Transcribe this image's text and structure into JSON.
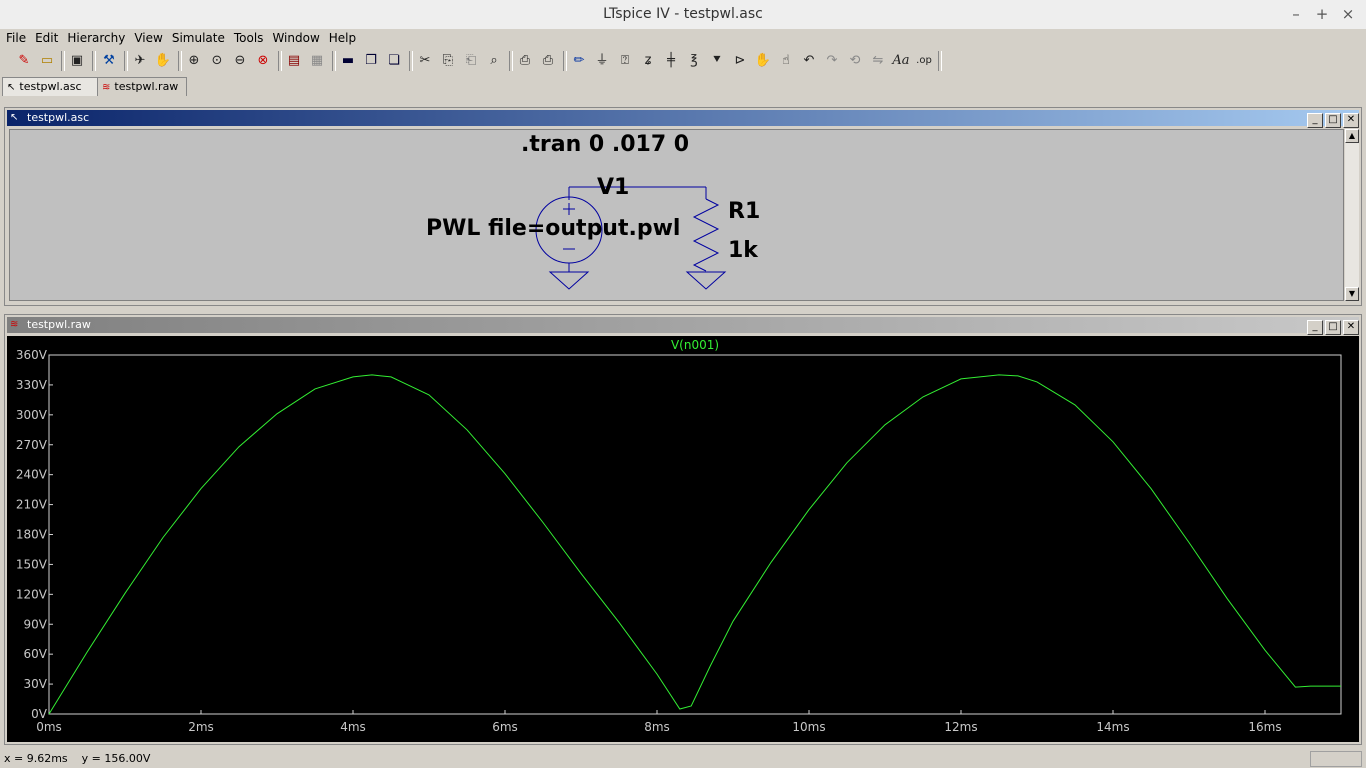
{
  "window": {
    "title": "LTspice IV - testpwl.asc"
  },
  "menu": [
    "File",
    "Edit",
    "Hierarchy",
    "View",
    "Simulate",
    "Tools",
    "Window",
    "Help"
  ],
  "tabs": [
    {
      "label": "testpwl.asc",
      "icon": "schematic-icon"
    },
    {
      "label": "testpwl.raw",
      "icon": "waveform-icon"
    }
  ],
  "schematic_window": {
    "title": "testpwl.asc",
    "directive": ".tran 0 .017 0",
    "source_name": "V1",
    "source_value": "PWL file=output.pwl",
    "resistor_name": "R1",
    "resistor_value": "1k"
  },
  "waveform_window": {
    "title": "testpwl.raw",
    "trace_color": "#33ee33"
  },
  "status": {
    "coords": "x = 9.62ms    y = 156.00V"
  },
  "chart_data": {
    "type": "line",
    "series": [
      {
        "name": "V(n001)",
        "x_unit": "ms",
        "x": [
          0,
          0.5,
          1,
          1.5,
          2,
          2.5,
          3,
          3.5,
          4,
          4.25,
          4.5,
          5,
          5.5,
          6,
          6.5,
          7,
          7.5,
          8,
          8.3,
          8.45,
          8.7,
          9,
          9.5,
          10,
          10.5,
          11,
          11.5,
          12,
          12.5,
          12.75,
          13,
          13.5,
          14,
          14.5,
          15,
          15.5,
          16,
          16.4,
          16.6,
          17
        ],
        "y": [
          0,
          62,
          121,
          177,
          226,
          268,
          301,
          326,
          338,
          340,
          338,
          320,
          285,
          241,
          192,
          141,
          92,
          40,
          5,
          8,
          48,
          93,
          152,
          205,
          252,
          290,
          318,
          336,
          340,
          339,
          333,
          310,
          273,
          226,
          172,
          116,
          64,
          27,
          28,
          28
        ]
      }
    ],
    "xlim": [
      0,
      17
    ],
    "ylim": [
      0,
      360
    ],
    "x_ticks": [
      "0ms",
      "2ms",
      "4ms",
      "6ms",
      "8ms",
      "10ms",
      "12ms",
      "14ms",
      "16ms"
    ],
    "y_ticks": [
      "0V",
      "30V",
      "60V",
      "90V",
      "120V",
      "150V",
      "180V",
      "210V",
      "240V",
      "270V",
      "300V",
      "330V",
      "360V"
    ],
    "grid": false,
    "background": "#000000"
  }
}
